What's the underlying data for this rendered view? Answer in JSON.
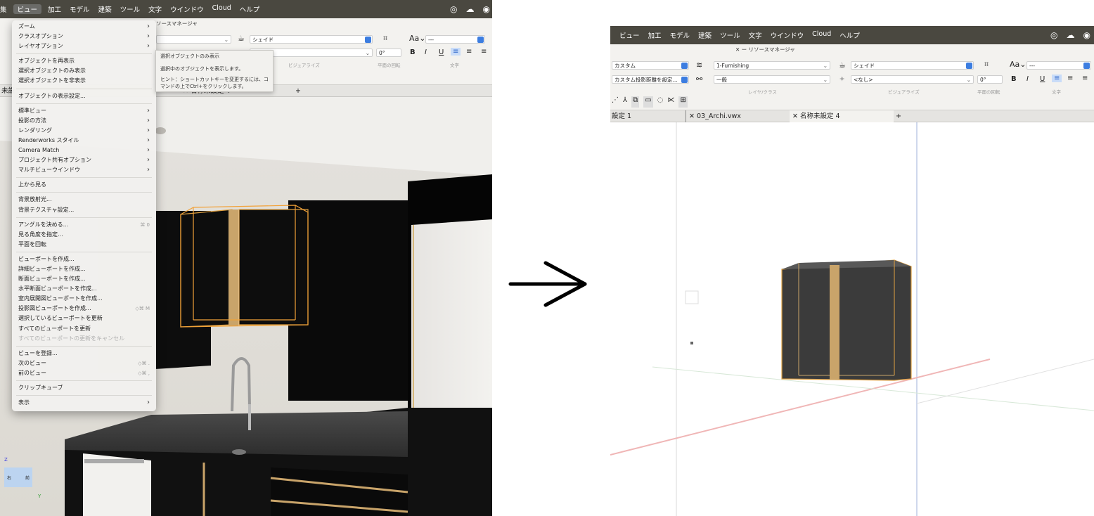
{
  "left": {
    "menu_items": [
      "集",
      "ビュー",
      "加工",
      "モデル",
      "建築",
      "ツール",
      "文字",
      "ウインドウ",
      "Cloud",
      "ヘルプ"
    ],
    "active_menu": "ビュー",
    "resource_manager_label": "ソースマネージャ",
    "toolbar": {
      "class_value": "",
      "render_value": "シェイド",
      "angle_value": "0°",
      "visualize_label": "ビジュアライズ",
      "rotate_label": "平面の回転",
      "text_style_value": "---",
      "text_label": "文字",
      "font_btn": "Aa⌄"
    },
    "tabs": [
      "未設",
      "✕ 名称未設定 4"
    ],
    "tab_add": "+",
    "dropdown": [
      {
        "label": "ズーム",
        "arrow": true
      },
      {
        "label": "クラスオプション",
        "arrow": true
      },
      {
        "label": "レイヤオプション",
        "arrow": true
      },
      {
        "sep": true
      },
      {
        "label": "オブジェクトを再表示"
      },
      {
        "label": "選択オブジェクトのみ表示"
      },
      {
        "label": "選択オブジェクトを非表示"
      },
      {
        "sep": true
      },
      {
        "label": "オブジェクトの表示設定..."
      },
      {
        "sep": true
      },
      {
        "label": "標準ビュー",
        "arrow": true
      },
      {
        "label": "投影の方法",
        "arrow": true
      },
      {
        "label": "レンダリング",
        "arrow": true
      },
      {
        "label": "Renderworks スタイル",
        "arrow": true
      },
      {
        "label": "Camera Match",
        "arrow": true
      },
      {
        "label": "プロジェクト共有オプション",
        "arrow": true
      },
      {
        "label": "マルチビューウインドウ",
        "arrow": true
      },
      {
        "sep": true
      },
      {
        "label": "上から見る"
      },
      {
        "sep": true
      },
      {
        "label": "背景放射光..."
      },
      {
        "label": "背景テクスチャ設定..."
      },
      {
        "sep": true
      },
      {
        "label": "アングルを決める...",
        "sc": "⌘ 0"
      },
      {
        "label": "見る角度を指定..."
      },
      {
        "label": "平面を回転"
      },
      {
        "sep": true
      },
      {
        "label": "ビューポートを作成..."
      },
      {
        "label": "詳細ビューポートを作成..."
      },
      {
        "label": "断面ビューポートを作成..."
      },
      {
        "label": "水平断面ビューポートを作成..."
      },
      {
        "label": "室内展開図ビューポートを作成..."
      },
      {
        "label": "投影図ビューポートを作成...",
        "sc": "◇⌘ M"
      },
      {
        "label": "選択しているビューポートを更新"
      },
      {
        "label": "すべてのビューポートを更新"
      },
      {
        "label": "すべてのビューポートの更新をキャンセル",
        "disabled": true
      },
      {
        "sep": true
      },
      {
        "label": "ビューを登録..."
      },
      {
        "label": "次のビュー",
        "sc": "◇⌘ ."
      },
      {
        "label": "前のビュー",
        "sc": "◇⌘ ,"
      },
      {
        "sep": true
      },
      {
        "label": "クリップキューブ"
      },
      {
        "sep": true
      },
      {
        "label": "表示",
        "arrow": true
      }
    ],
    "tooltip": {
      "title": "選択オブジェクトのみ表示",
      "desc": "選択中のオブジェクトを表示します。",
      "hint": "ヒント：ショートカットキーを変更するには、コマンドの上でCtrl+をクリックします。"
    },
    "axis_z": "Z",
    "axis_y": "Y",
    "cube_labels": [
      "右",
      "前"
    ]
  },
  "right": {
    "menu_items": [
      "ビュー",
      "加工",
      "モデル",
      "建築",
      "ツール",
      "文字",
      "ウインドウ",
      "Cloud",
      "ヘルプ"
    ],
    "resource_manager_label": "✕ ー リソースマネージャ",
    "row1": {
      "class_value": "カスタム",
      "layer_value": "1-Furnishing",
      "render_value": "シェイド",
      "text_style_value": "---",
      "font_btn": "Aa⌄"
    },
    "row2": {
      "class_value": "カスタム投影距離を設定...",
      "layer_value": "一般",
      "render_value": "<なし>",
      "angle_value": "0°"
    },
    "labels": {
      "layer_class": "レイヤ/クラス",
      "visualize": "ビジュアライズ",
      "rotate": "平面の回転",
      "text": "文字"
    },
    "tabs": [
      "設定 1",
      "✕ 03_Archi.vwx",
      "✕ 名称未設定 4"
    ],
    "tab_add": "+"
  },
  "arrow_symbol": "→"
}
